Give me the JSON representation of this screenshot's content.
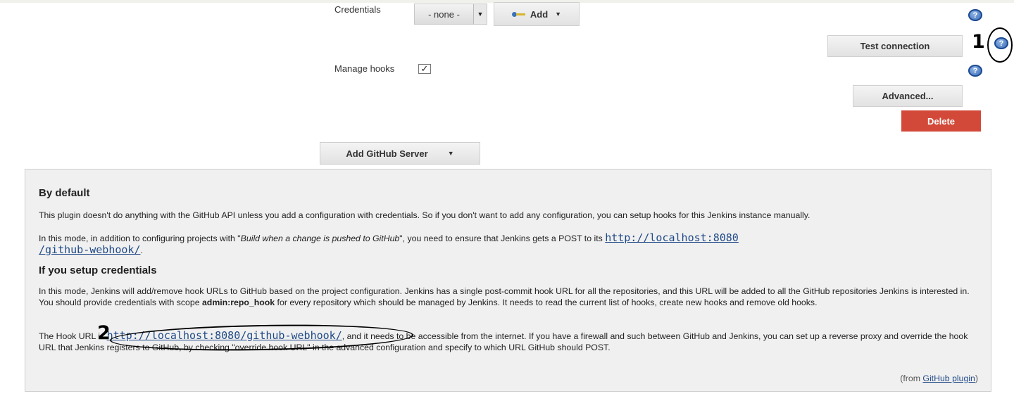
{
  "form": {
    "credentials_label": "Credentials",
    "credentials_select_value": "- none -",
    "add_button_label": "Add",
    "test_connection_label": "Test connection",
    "manage_hooks_label": "Manage hooks",
    "manage_hooks_checked": true,
    "advanced_label": "Advanced...",
    "delete_label": "Delete",
    "add_server_label": "Add GitHub Server",
    "help_icon_glyph": "?",
    "checkbox_glyph": "✓",
    "caret_glyph": "▼"
  },
  "annotations": {
    "marker_1": "1",
    "marker_2": "2"
  },
  "help_panel": {
    "heading_default": "By default",
    "default_p1": "This plugin doesn't do anything with the GitHub API unless you add a configuration with credentials. So if you don't want to add any configuration, you can setup hooks for this Jenkins instance manually.",
    "default_p2_pre": "In this mode, in addition to configuring projects with \"",
    "default_p2_italic": "Build when a change is pushed to GitHub",
    "default_p2_mid": "\", you need to ensure that Jenkins gets a POST to its ",
    "default_p2_link_a": "http://localhost:8080",
    "default_p2_link_b": "/github-webhook/",
    "default_p2_end": ".",
    "heading_credentials": "If you setup credentials",
    "cred_p1_pre": "In this mode, Jenkins will add/remove hook URLs to GitHub based on the project configuration. Jenkins has a single post-commit hook URL for all the repositories, and this URL will be added to all the GitHub repositories Jenkins is interested in. You should provide credentials with scope ",
    "cred_p1_bold": "admin:repo_hook",
    "cred_p1_post": " for every repository which should be managed by Jenkins. It needs to read the current list of hooks, create new hooks and remove old hooks.",
    "cred_p2_pre": "The Hook URL is ",
    "cred_p2_link": "http://localhost:8080/github-webhook/",
    "cred_p2_post": ", and it needs to be accessible from the internet. If you have a firewall and such between GitHub and Jenkins, you can set up a reverse proxy and override the hook URL that Jenkins registers to GitHub, by checking \"override hook URL\" in the advanced configuration and specify to which URL GitHub should POST.",
    "from_pre": "(from ",
    "from_link": "GitHub plugin",
    "from_post": ")"
  },
  "colors": {
    "delete_button": "#d24939",
    "link": "#204a87",
    "panel_bg": "#f0f0f0"
  },
  "icons": [
    "key-icon",
    "help-icon",
    "caret-down-icon",
    "checkmark-icon"
  ]
}
